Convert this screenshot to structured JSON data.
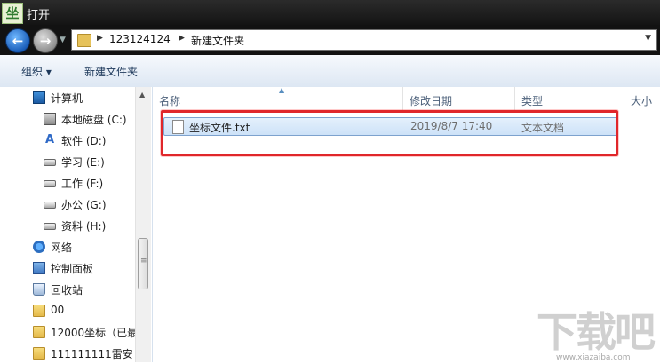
{
  "window": {
    "title": "打开",
    "title_icon_glyph": "坐"
  },
  "address": {
    "crumbs": [
      "123124124",
      "新建文件夹"
    ]
  },
  "toolbar": {
    "organize": "组织 ▾",
    "new_folder": "新建文件夹"
  },
  "nav": {
    "items": [
      {
        "label": "计算机",
        "icon": "computer-icon"
      },
      {
        "label": "本地磁盘 (C:)",
        "icon": "system-drive-icon"
      },
      {
        "label": "软件 (D:)",
        "icon": "dvd-drive-icon"
      },
      {
        "label": "学习 (E:)",
        "icon": "drive-icon"
      },
      {
        "label": "工作 (F:)",
        "icon": "drive-icon"
      },
      {
        "label": "办公 (G:)",
        "icon": "drive-icon"
      },
      {
        "label": "资料 (H:)",
        "icon": "drive-icon"
      },
      {
        "label": "网络",
        "icon": "network-icon"
      },
      {
        "label": "控制面板",
        "icon": "control-panel-icon"
      },
      {
        "label": "回收站",
        "icon": "recycle-bin-icon"
      },
      {
        "label": "00",
        "icon": "folder-icon"
      },
      {
        "label": "12000坐标（已最",
        "icon": "folder-icon"
      },
      {
        "label": "111111111雷安",
        "icon": "folder-icon"
      }
    ]
  },
  "columns": {
    "name": "名称",
    "modified": "修改日期",
    "type": "类型",
    "size": "大小"
  },
  "files": [
    {
      "name": "坐标文件.txt",
      "modified": "2019/8/7 17:40",
      "type": "文本文档"
    }
  ],
  "colors": {
    "highlight": "#e0262a",
    "selection": "#cde2f8"
  },
  "watermark": {
    "text": "下载吧",
    "sub": "www.xiazaiba.com"
  }
}
